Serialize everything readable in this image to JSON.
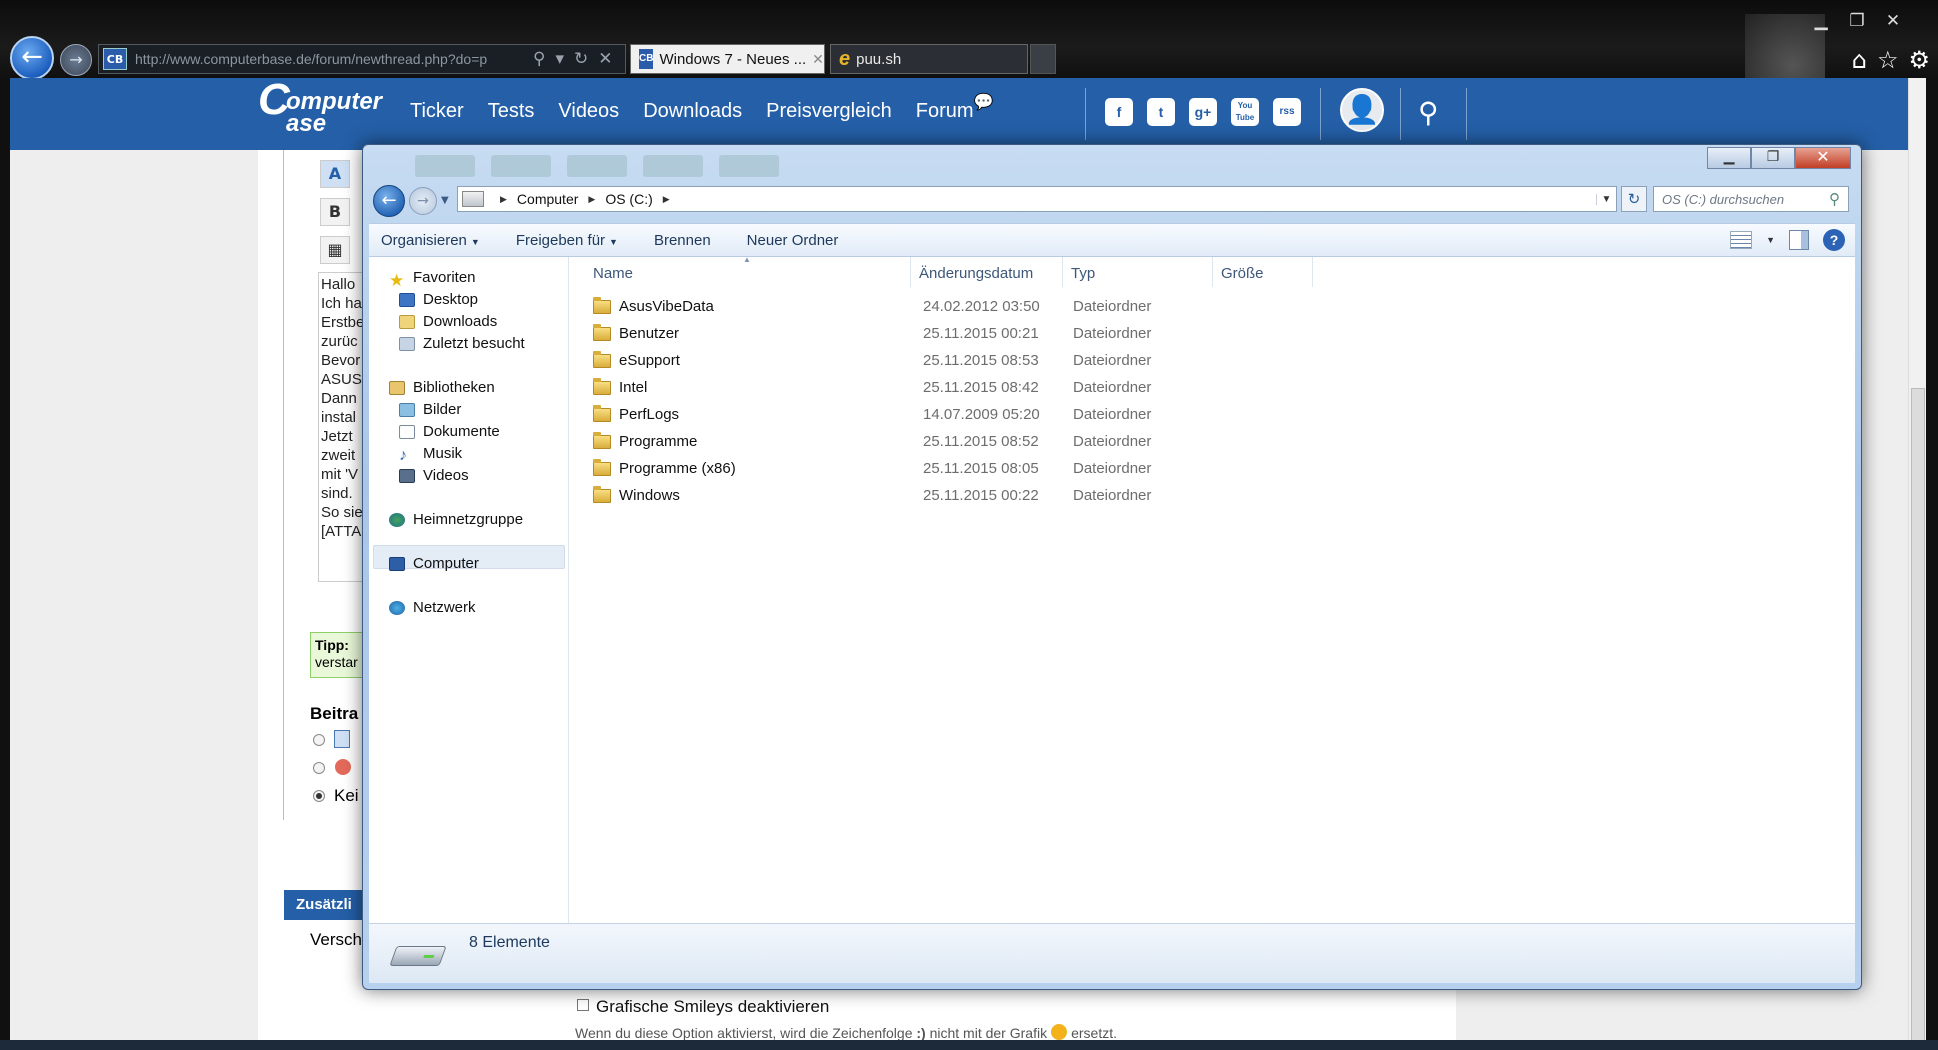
{
  "browser": {
    "address_url": "http://www.computerbase.de/forum/newthread.php?do=p",
    "tabs": [
      {
        "label": "Windows 7 - Neues ...",
        "active": true
      },
      {
        "label": "puu.sh",
        "active": false
      }
    ]
  },
  "site": {
    "logo_line1": "omputer",
    "logo_line2": "ase",
    "logo_c": "C",
    "nav": [
      "Ticker",
      "Tests",
      "Videos",
      "Downloads",
      "Preisvergleich",
      "Forum"
    ],
    "social": [
      "f",
      "t",
      "g+",
      "You Tube",
      "rss"
    ]
  },
  "forum_page": {
    "editor_lines": [
      "Hallo",
      "Ich ha",
      "Erstbe",
      "zurüc",
      "Bevor",
      "ASUS",
      "Dann",
      "instal",
      "Jetzt",
      "zweit",
      "mit 'V",
      "sind.",
      "So sie",
      "[ATTA"
    ],
    "tipp_title": "Tipp:",
    "tipp_text": "verstar",
    "beitrag_title": "Beitra",
    "keine_label": "Kei",
    "zusatz_header": "Zusätzli",
    "versch_label": "Versch",
    "smiley_label": "Grafische Smileys deaktivieren",
    "smiley_hint_prefix": "Wenn du diese Option aktivierst, wird die Zeichenfolge",
    "smiley_hint_code": ":)",
    "smiley_hint_middle": "nicht mit der Grafik",
    "smiley_hint_suffix": "ersetzt."
  },
  "explorer": {
    "breadcrumb": [
      "Computer",
      "OS (C:)"
    ],
    "search_placeholder": "OS (C:) durchsuchen",
    "commands": [
      {
        "label": "Organisieren",
        "dropdown": true
      },
      {
        "label": "Freigeben für",
        "dropdown": true
      },
      {
        "label": "Brennen",
        "dropdown": false
      },
      {
        "label": "Neuer Ordner",
        "dropdown": false
      }
    ],
    "nav_tree": {
      "favoriten": "Favoriten",
      "desktop": "Desktop",
      "downloads": "Downloads",
      "zuletzt": "Zuletzt besucht",
      "bibliotheken": "Bibliotheken",
      "bilder": "Bilder",
      "dokumente": "Dokumente",
      "musik": "Musik",
      "videos": "Videos",
      "heimnetzgruppe": "Heimnetzgruppe",
      "computer": "Computer",
      "netzwerk": "Netzwerk"
    },
    "columns": {
      "name": "Name",
      "date": "Änderungsdatum",
      "type": "Typ",
      "size": "Größe"
    },
    "files": [
      {
        "name": "AsusVibeData",
        "date": "24.02.2012 03:50",
        "type": "Dateiordner"
      },
      {
        "name": "Benutzer",
        "date": "25.11.2015 00:21",
        "type": "Dateiordner"
      },
      {
        "name": "eSupport",
        "date": "25.11.2015 08:53",
        "type": "Dateiordner"
      },
      {
        "name": "Intel",
        "date": "25.11.2015 08:42",
        "type": "Dateiordner"
      },
      {
        "name": "PerfLogs",
        "date": "14.07.2009 05:20",
        "type": "Dateiordner"
      },
      {
        "name": "Programme",
        "date": "25.11.2015 08:52",
        "type": "Dateiordner"
      },
      {
        "name": "Programme (x86)",
        "date": "25.11.2015 08:05",
        "type": "Dateiordner"
      },
      {
        "name": "Windows",
        "date": "25.11.2015 00:22",
        "type": "Dateiordner"
      }
    ],
    "status_count": "8 Elemente"
  }
}
